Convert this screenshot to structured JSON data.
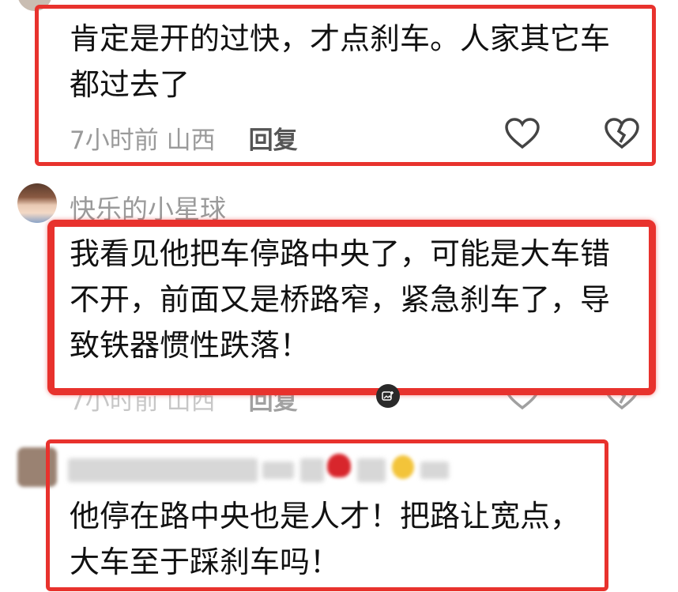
{
  "comments": [
    {
      "text": "肯定是开的过快，才点刹车。人家其它车都过去了",
      "time_location": "7小时前 山西",
      "reply_label": "回复"
    },
    {
      "username": "快乐的小星球",
      "text": "我看见他把车停路中央了，可能是大车错不开，前面又是桥路窄，紧急刹车了，导致铁器惯性跌落！",
      "time_location": "7小时前 山西",
      "reply_label": "回复"
    },
    {
      "text": "他停在路中央也是人才！把路让宽点，大车至于踩刹车吗！"
    }
  ],
  "colors": {
    "highlight": "#e8322d",
    "meta": "#9a9a9a"
  },
  "icons": [
    "heart-outline-icon",
    "broken-heart-icon",
    "image-edit-icon"
  ]
}
